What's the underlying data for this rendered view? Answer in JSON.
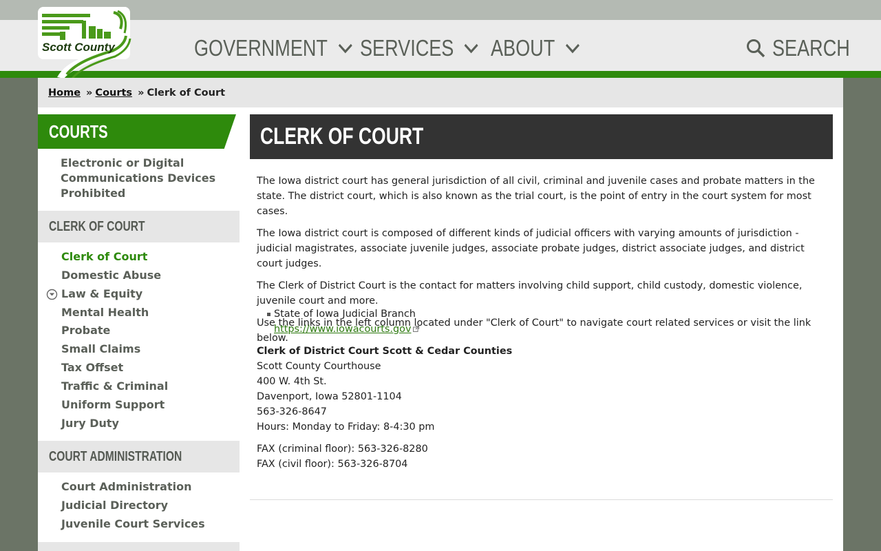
{
  "header": {
    "logo_text": "Scott County",
    "nav": [
      {
        "label": "GOVERNMENT"
      },
      {
        "label": "SERVICES"
      },
      {
        "label": "ABOUT"
      }
    ],
    "search_label": "SEARCH"
  },
  "breadcrumb": {
    "home": "Home",
    "sep": "»",
    "courts": "Courts",
    "current": "Clerk of Court"
  },
  "sidebar": {
    "heading": "COURTS",
    "top_link": "Electronic or Digital Communications Devices Prohibited",
    "sections": [
      {
        "title": "CLERK OF COURT",
        "links": [
          "Clerk of Court",
          "Domestic Abuse",
          "Law & Equity",
          "Mental Health",
          "Probate",
          "Small Claims",
          "Tax Offset",
          "Traffic & Criminal",
          "Uniform Support",
          "Jury Duty"
        ]
      },
      {
        "title": "COURT ADMINISTRATION",
        "links": [
          "Court Administration",
          "Judicial Directory",
          "Juvenile Court Services"
        ]
      }
    ]
  },
  "main": {
    "title": "CLERK OF COURT",
    "paragraphs": [
      "The Iowa district court has general jurisdiction of all civil, criminal and juvenile cases and probate matters in the state. The district court, which is also known as the trial court, is the point of entry in the court system for most cases.",
      "The Iowa district court is composed of different kinds of judicial officers with varying amounts of jurisdiction - judicial magistrates, associate juvenile judges, associate probate judges, district associate judges, and district court judges.",
      "The Clerk of District Court is the contact for matters involving child support, child custody, domestic violence, juvenile court and more.",
      "Use the links in the left column located under \"Clerk of Court\" to navigate court related services or visit the link below."
    ],
    "bullet_label": "State of Iowa Judicial Branch",
    "bullet_link": "https://www.iowacourts.gov",
    "contact": {
      "heading": "Clerk of District Court Scott & Cedar Counties",
      "lines": [
        "Scott County Courthouse",
        "400 W. 4th St.",
        "Davenport, Iowa 52801-1104",
        "563-326-8647",
        "Hours: Monday to Friday: 8-4:30 pm"
      ],
      "fax": [
        "FAX (criminal floor): 563-326-8280",
        "FAX (civil floor): 563-326-8704"
      ]
    }
  },
  "colors": {
    "brand_green": "#2e8a0c",
    "title_bar": "#333333",
    "nav_text": "#5a6058"
  }
}
